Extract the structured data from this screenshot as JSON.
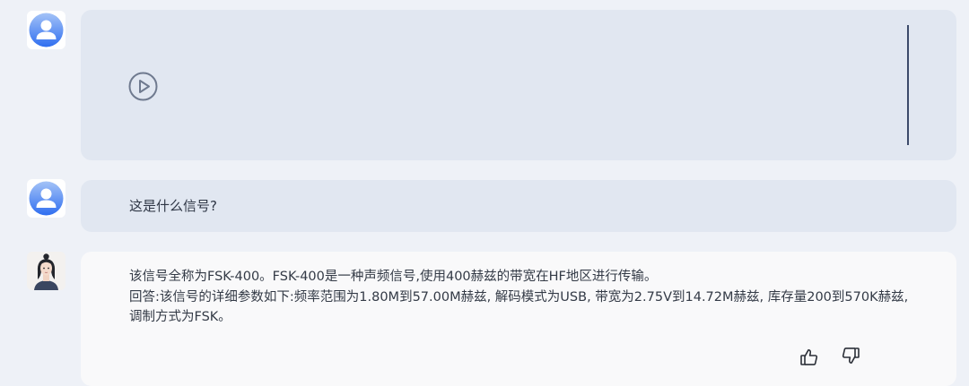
{
  "conversation": {
    "messages": [
      {
        "role": "user",
        "type": "audio",
        "play_icon": "play-icon"
      },
      {
        "role": "user",
        "type": "text",
        "text": "这是什么信号?"
      },
      {
        "role": "assistant",
        "type": "text",
        "paragraphs": [
          "该信号全称为FSK-400。FSK-400是一种声频信号,使用400赫兹的带宽在HF地区进行传输。",
          "回答:该信号的详细参数如下:频率范围为1.80M到57.00M赫兹, 解码模式为USB, 带宽为2.75V到14.72M赫兹, 库存量200到570K赫兹, 调制方式为FSK。"
        ],
        "actions": [
          "thumbs-up-icon",
          "thumbs-down-icon"
        ]
      }
    ]
  },
  "colors": {
    "page_background": "#eef1f7",
    "user_bubble": "#e1e7f1",
    "assistant_bubble": "#f9f9fa",
    "user_avatar_gradient": [
      "#a4c3f7",
      "#2f6ef0"
    ]
  }
}
